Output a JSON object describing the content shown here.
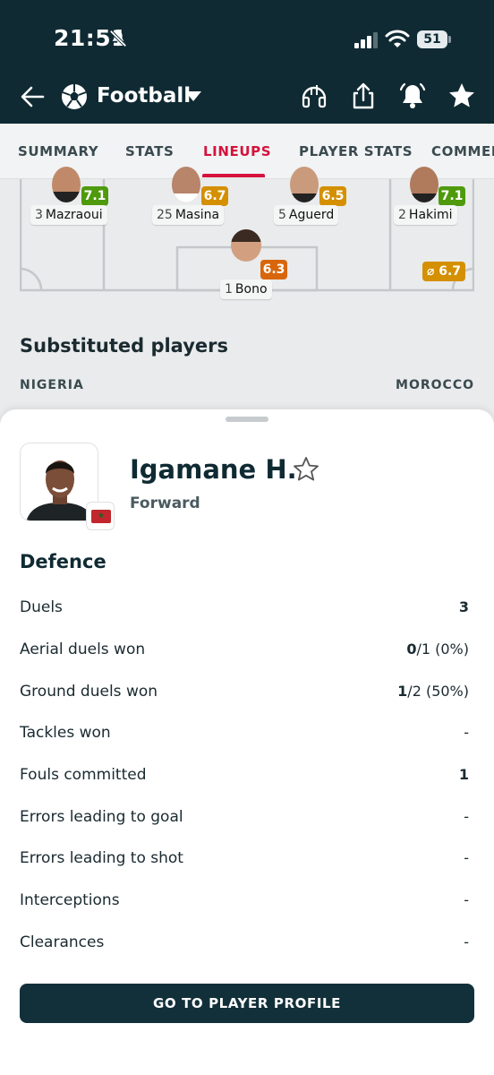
{
  "status_bar": {
    "time": "21:51",
    "battery": "51"
  },
  "header": {
    "sport": "Football"
  },
  "tabs": [
    {
      "label": "SUMMARY",
      "active": false
    },
    {
      "label": "STATS",
      "active": false
    },
    {
      "label": "LINEUPS",
      "active": true
    },
    {
      "label": "PLAYER STATS",
      "active": false
    },
    {
      "label": "COMMEN",
      "active": false
    }
  ],
  "lineup": {
    "players": [
      {
        "number": "3",
        "name": "Mazraoui",
        "rating": "7.1",
        "rating_color": "#4e9a0c"
      },
      {
        "number": "25",
        "name": "Masina",
        "rating": "6.7",
        "rating_color": "#d49000"
      },
      {
        "number": "5",
        "name": "Aguerd",
        "rating": "6.5",
        "rating_color": "#d49000"
      },
      {
        "number": "2",
        "name": "Hakimi",
        "rating": "7.1",
        "rating_color": "#4e9a0c"
      },
      {
        "number": "1",
        "name": "Bono",
        "rating": "6.3",
        "rating_color": "#d8660c"
      }
    ],
    "average_rating": "⌀ 6.7"
  },
  "substituted": {
    "title": "Substituted players",
    "team_left": "NIGERIA",
    "team_right": "MOROCCO"
  },
  "sheet": {
    "player_name": "Igamane H.",
    "position": "Forward",
    "section_title": "Defence",
    "stats": [
      {
        "label": "Duels",
        "value_bold": "3",
        "value_rest": ""
      },
      {
        "label": "Aerial duels won",
        "value_bold": "0",
        "value_rest": "/1 (0%)"
      },
      {
        "label": "Ground duels won",
        "value_bold": "1",
        "value_rest": "/2 (50%)"
      },
      {
        "label": "Tackles won",
        "value_bold": "",
        "value_rest": "-"
      },
      {
        "label": "Fouls committed",
        "value_bold": "1",
        "value_rest": ""
      },
      {
        "label": "Errors leading to goal",
        "value_bold": "",
        "value_rest": "-"
      },
      {
        "label": "Errors leading to shot",
        "value_bold": "",
        "value_rest": "-"
      },
      {
        "label": "Interceptions",
        "value_bold": "",
        "value_rest": "-"
      },
      {
        "label": "Clearances",
        "value_bold": "",
        "value_rest": "-"
      }
    ],
    "cta_label": "GO TO PLAYER PROFILE"
  },
  "colors": {
    "header_bg": "#0f2a33",
    "accent": "#d4123c",
    "cta_bg": "#12303a"
  },
  "icons": [
    "bell-off-icon",
    "signal-icon",
    "wifi-icon",
    "battery-icon",
    "back-arrow-icon",
    "football-icon",
    "caret-down-icon",
    "live-stream-icon",
    "share-icon",
    "notification-bell-icon",
    "favorite-star-icon",
    "star-outline-icon",
    "morocco-flag-icon"
  ]
}
